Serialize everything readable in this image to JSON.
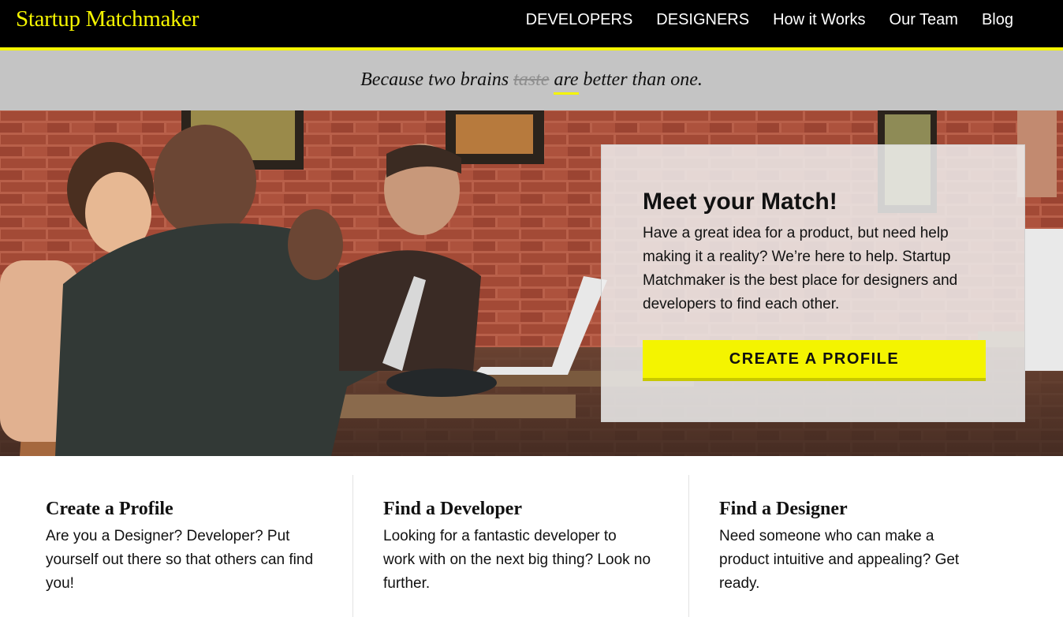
{
  "header": {
    "logo": "Startup Matchmaker",
    "nav": [
      "DEVELOPERS",
      "DESIGNERS",
      "How it Works",
      "Our Team",
      "Blog"
    ]
  },
  "tagline": {
    "before": "Because two brains ",
    "struck": "taste",
    "underlined": "are",
    "after": " better than one."
  },
  "hero": {
    "photo": "people working on laptops at a cafe with brick wall",
    "card": {
      "title": "Meet your Match!",
      "body": "Have a great idea for a product, but need help making it a reality? We’re here to help. Startup Matchmaker is the best place for designers and developers to find each other.",
      "cta": "CREATE A PROFILE"
    }
  },
  "features": [
    {
      "title": "Create a Profile",
      "body": "Are you a Designer? Developer? Put yourself out there so that others can find you!"
    },
    {
      "title": "Find a Developer",
      "body": "Looking for a fantastic developer to work with on the next big thing? Look no further."
    },
    {
      "title": "Find a Designer",
      "body": "Need someone who can make a product intuitive and appealing? Get ready."
    }
  ],
  "colors": {
    "accent": "#f4f400",
    "header_bg": "#000000",
    "tagline_bg": "#c4c4c4"
  }
}
